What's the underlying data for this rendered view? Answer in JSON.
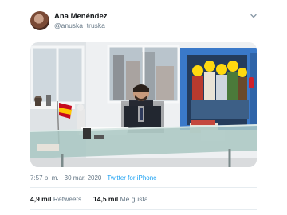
{
  "author": {
    "name": "Ana Menéndez",
    "handle": "@anuska_truska",
    "avatar_icon": "avatar-photo"
  },
  "menu_icon": "chevron-down-icon",
  "media": {
    "description_icon": "office-photo-with-flag-and-cartoon-door",
    "accent_colors": {
      "flag_red": "#c60b1e",
      "flag_yellow": "#ffc400",
      "door": "#3a79c9",
      "desk_glass": "#a9c7c2"
    }
  },
  "timestamp": "7:57 p. m. · 30 mar. 2020",
  "source_separator": "·",
  "source": "Twitter for iPhone",
  "stats": {
    "retweets_count": "4,9 mil",
    "retweets_label": "Retweets",
    "likes_count": "14,5 mil",
    "likes_label": "Me gusta"
  },
  "colors": {
    "link": "#1da1f2",
    "muted": "#657786",
    "text": "#14171a",
    "divider": "#e6ecf0"
  }
}
